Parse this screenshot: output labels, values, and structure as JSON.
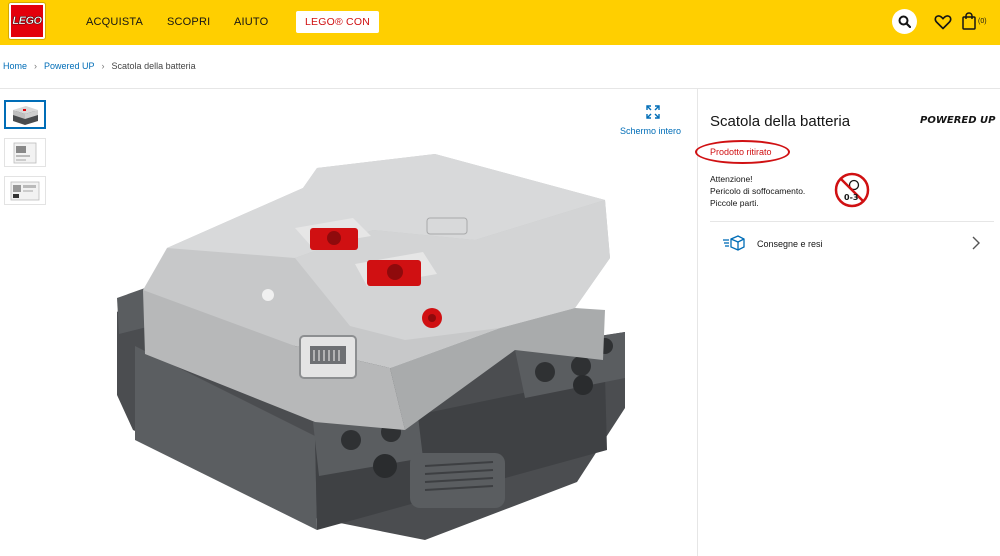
{
  "header": {
    "logo_text": "LEGO",
    "nav": [
      "ACQUISTA",
      "SCOPRI",
      "AIUTO"
    ],
    "con_button": "LEGO® CON",
    "bag_count": "(0)"
  },
  "breadcrumb": {
    "items": [
      "Home",
      "Powered UP"
    ],
    "current": "Scatola della batteria"
  },
  "gallery": {
    "fullscreen_label": "Schermo intero"
  },
  "product": {
    "title": "Scatola della batteria",
    "brand_text": "POWERED UP",
    "status": "Prodotto ritirato",
    "warning_lines": [
      "Attenzione!",
      "Pericolo di soffocamento.",
      "Piccole parti."
    ],
    "age_label": "0-3",
    "delivery_label": "Consegne e resi"
  },
  "colors": {
    "header_bg": "#ffcf00",
    "lego_red": "#e3000b",
    "link_blue": "#006db7",
    "status_red": "#d01012"
  },
  "icons": [
    "search-icon",
    "heart-icon",
    "bag-icon",
    "fullscreen-icon",
    "choking-hazard-icon",
    "delivery-box-icon",
    "chevron-right-icon"
  ]
}
